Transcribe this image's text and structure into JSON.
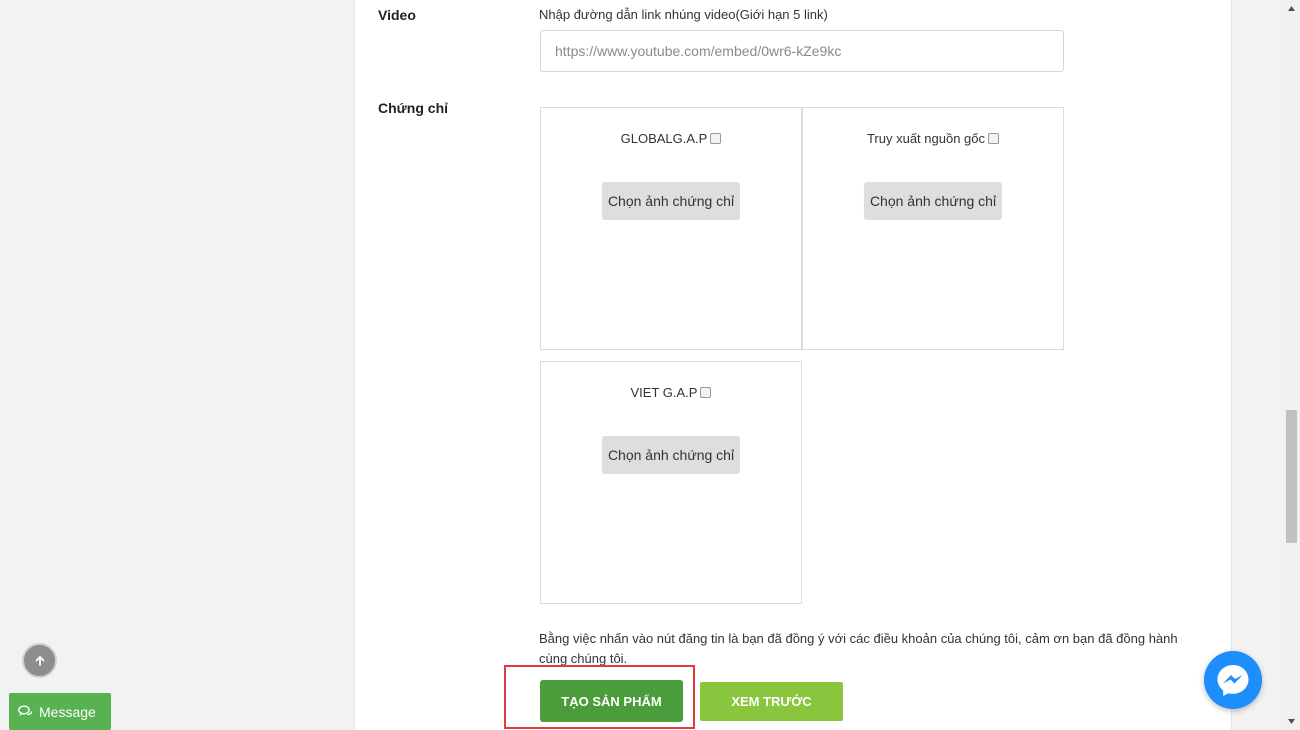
{
  "video": {
    "label": "Video",
    "hint": "Nhập đường dẫn link nhúng video(Giới hạn 5 link)",
    "placeholder": "https://www.youtube.com/embed/0wr6-kZe9kc"
  },
  "certificates": {
    "label": "Chứng chỉ",
    "items": [
      {
        "name": "GLOBALG.A.P",
        "button": "Chọn ảnh chứng chỉ"
      },
      {
        "name": "Truy xuất nguồn gốc",
        "button": "Chọn ảnh chứng chỉ"
      },
      {
        "name": "VIET G.A.P",
        "button": "Chọn ảnh chứng chỉ"
      }
    ]
  },
  "terms": "Bằng việc nhấn vào nút đăng tin là bạn đã đồng ý với các điều khoản của chúng tôi, cảm ơn bạn đã đồng hành cùng chúng tôi.",
  "actions": {
    "create": "TẠO SẢN PHẨM",
    "preview": "XEM TRƯỚC"
  },
  "widgets": {
    "message": "Message"
  },
  "colors": {
    "create_button": "#4a9d3a",
    "preview_button": "#8ac53e",
    "message_button": "#58b251",
    "highlight": "#e23b3b",
    "messenger": "#1d8ffd"
  }
}
